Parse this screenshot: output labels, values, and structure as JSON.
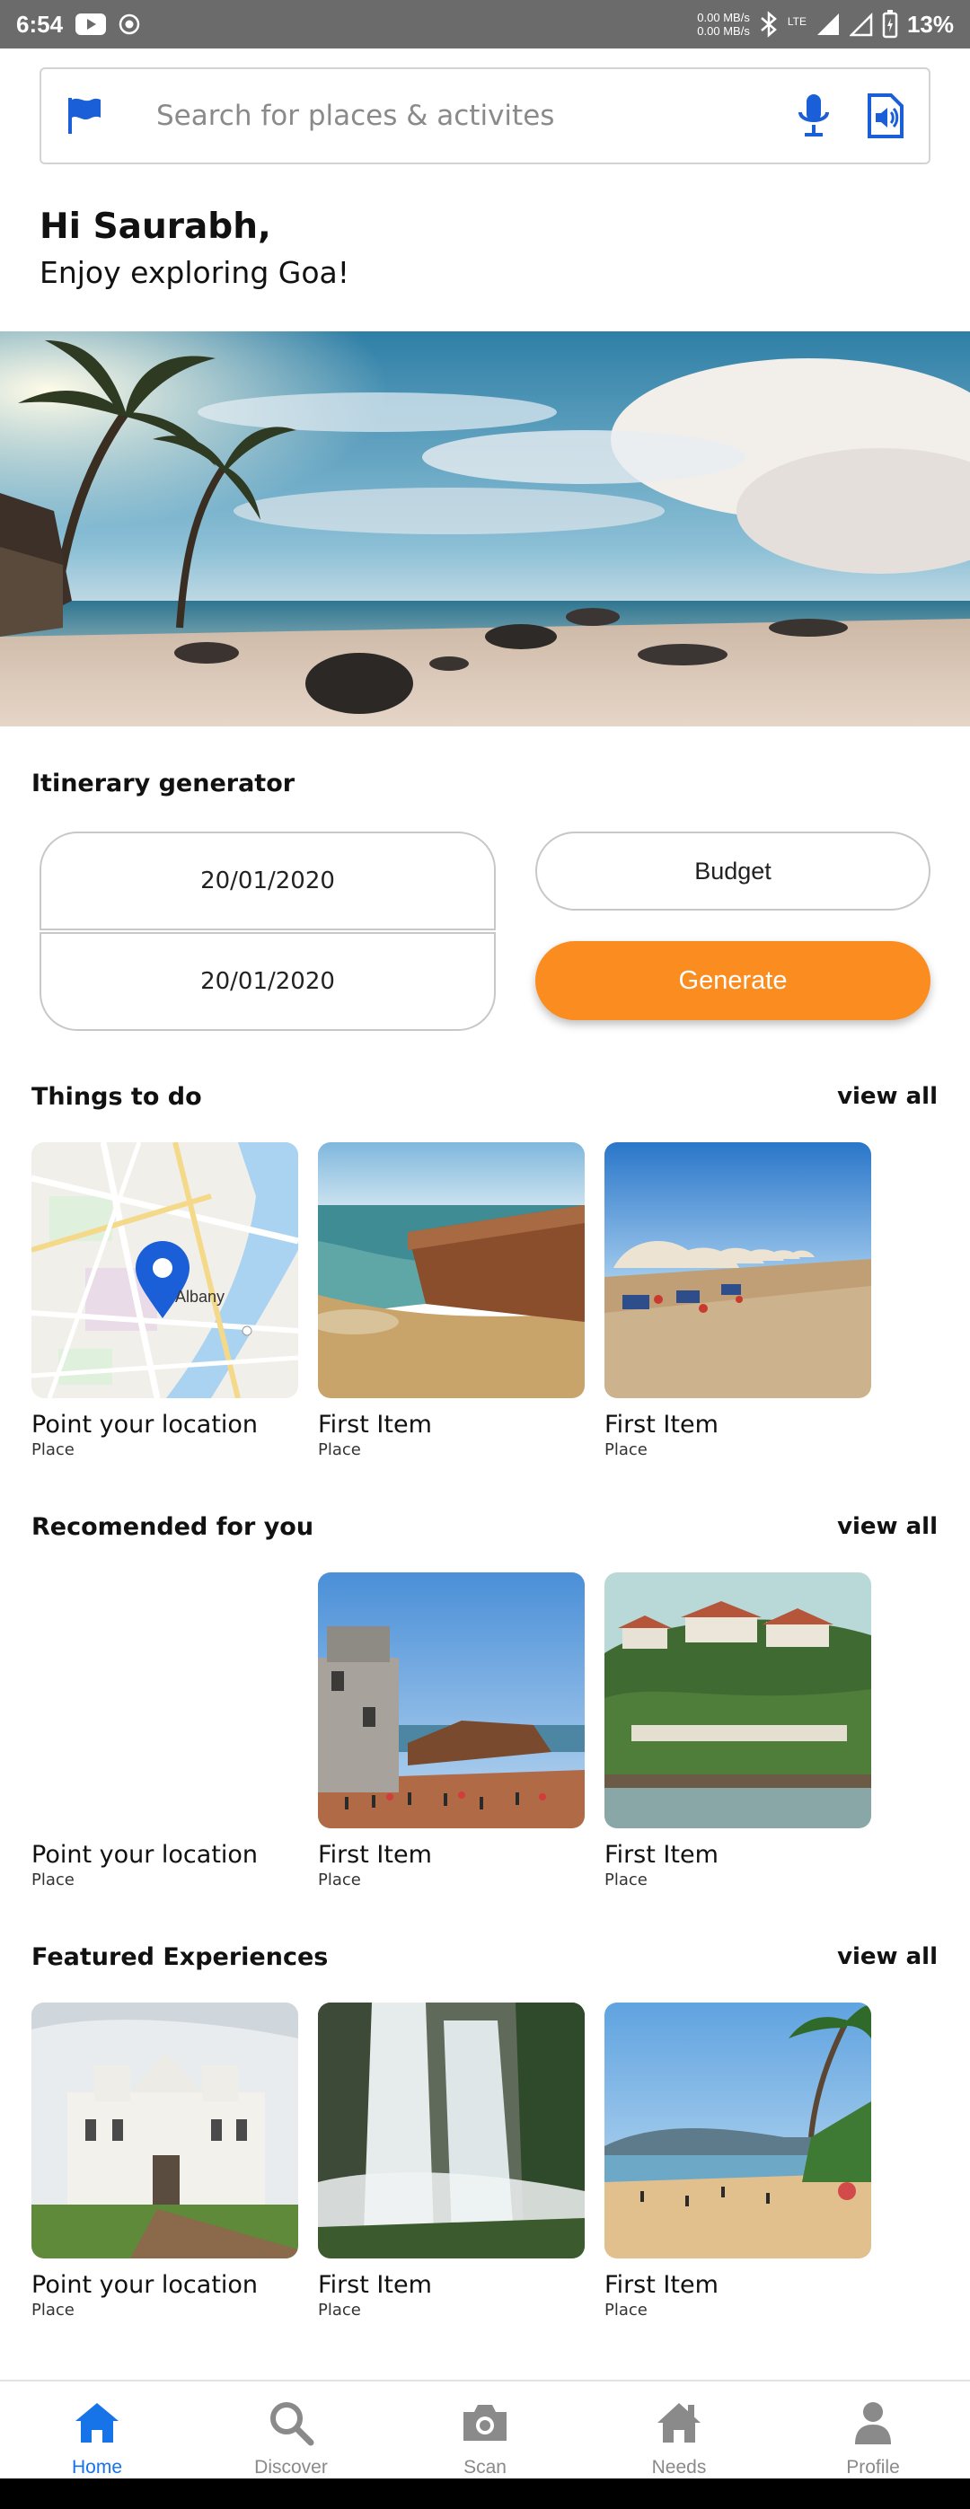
{
  "status_bar": {
    "time": "6:54",
    "speed_up": "0.00 MB/s",
    "speed_down": "0.00 MB/s",
    "network": "LTE",
    "battery": "13%"
  },
  "search": {
    "placeholder": "Search for places & activites"
  },
  "greeting": {
    "line1": "Hi Saurabh,",
    "line2": "Enjoy exploring Goa!"
  },
  "itinerary": {
    "title": "Itinerary generator",
    "start_date": "20/01/2020",
    "end_date": "20/01/2020",
    "budget_label": "Budget",
    "generate_label": "Generate"
  },
  "things_to_do": {
    "title": "Things to do",
    "view_all": "view all",
    "cards": [
      {
        "title": "Point your location",
        "subtitle": "Place"
      },
      {
        "title": "First Item",
        "subtitle": "Place"
      },
      {
        "title": "First Item",
        "subtitle": "Place"
      }
    ],
    "map_label": "Albany"
  },
  "recommended": {
    "title": "Recomended for you",
    "view_all": "view all",
    "cards": [
      {
        "title": "Point your location",
        "subtitle": "Place"
      },
      {
        "title": "First Item",
        "subtitle": "Place"
      },
      {
        "title": "First Item",
        "subtitle": "Place"
      }
    ]
  },
  "featured": {
    "title": "Featured Experiences",
    "view_all": "view all",
    "cards": [
      {
        "title": "Point your location",
        "subtitle": "Place"
      },
      {
        "title": "First Item",
        "subtitle": "Place"
      },
      {
        "title": "First Item",
        "subtitle": "Place"
      }
    ]
  },
  "bottom_nav": {
    "items": [
      {
        "label": "Home",
        "icon": "home-icon",
        "active": true
      },
      {
        "label": "Discover",
        "icon": "search-icon",
        "active": false
      },
      {
        "label": "Scan",
        "icon": "camera-icon",
        "active": false
      },
      {
        "label": "Needs",
        "icon": "house-icon",
        "active": false
      },
      {
        "label": "Profile",
        "icon": "person-icon",
        "active": false
      }
    ]
  },
  "colors": {
    "accent_blue": "#1673e8",
    "generate_orange": "#fb8c1f",
    "inactive_grey": "#8a8a8a"
  }
}
